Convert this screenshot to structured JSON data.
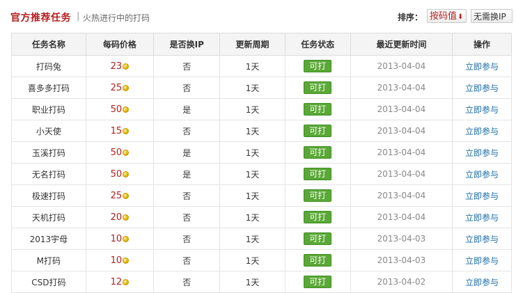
{
  "header": {
    "title": "官方推荐任务",
    "separator": "|",
    "subtitle": "火热进行中的打码",
    "sort_label": "排序：",
    "sort_price_label": "按码值",
    "sort_noip_label": "无需换IP"
  },
  "table": {
    "columns": [
      "任务名称",
      "每码价格",
      "是否换IP",
      "更新周期",
      "任务状态",
      "最近更新时间",
      "操作"
    ],
    "rows": [
      {
        "name": "打码兔",
        "price": "23",
        "change_ip": "否",
        "period": "1天",
        "status": "可打",
        "updated": "2013-04-04",
        "action": "立即参与"
      },
      {
        "name": "喜多多打码",
        "price": "25",
        "change_ip": "否",
        "period": "1天",
        "status": "可打",
        "updated": "2013-04-04",
        "action": "立即参与"
      },
      {
        "name": "职业打码",
        "price": "50",
        "change_ip": "是",
        "period": "1天",
        "status": "可打",
        "updated": "2013-04-04",
        "action": "立即参与"
      },
      {
        "name": "小天使",
        "price": "15",
        "change_ip": "否",
        "period": "1天",
        "status": "可打",
        "updated": "2013-04-04",
        "action": "立即参与"
      },
      {
        "name": "玉溪打码",
        "price": "50",
        "change_ip": "是",
        "period": "1天",
        "status": "可打",
        "updated": "2013-04-04",
        "action": "立即参与"
      },
      {
        "name": "无名打码",
        "price": "50",
        "change_ip": "是",
        "period": "1天",
        "status": "可打",
        "updated": "2013-04-04",
        "action": "立即参与"
      },
      {
        "name": "极速打码",
        "price": "25",
        "change_ip": "否",
        "period": "1天",
        "status": "可打",
        "updated": "2013-04-04",
        "action": "立即参与"
      },
      {
        "name": "天机打码",
        "price": "20",
        "change_ip": "否",
        "period": "1天",
        "status": "可打",
        "updated": "2013-04-04",
        "action": "立即参与"
      },
      {
        "name": "2013宇母",
        "price": "10",
        "change_ip": "否",
        "period": "1天",
        "status": "可打",
        "updated": "2013-04-03",
        "action": "立即参与"
      },
      {
        "name": "M打码",
        "price": "10",
        "change_ip": "否",
        "period": "1天",
        "status": "可打",
        "updated": "2013-04-03",
        "action": "立即参与"
      },
      {
        "name": "CSD打码",
        "price": "12",
        "change_ip": "否",
        "period": "1天",
        "status": "可打",
        "updated": "2013-04-02",
        "action": "立即参与"
      }
    ]
  },
  "icons": {
    "coin": "coin-icon",
    "sort_arrow": "arrow-down-icon"
  },
  "colors": {
    "title": "#b51e1e",
    "price": "#b51e1e",
    "status_badge": "#5aa836",
    "link": "#1a6ca6"
  }
}
